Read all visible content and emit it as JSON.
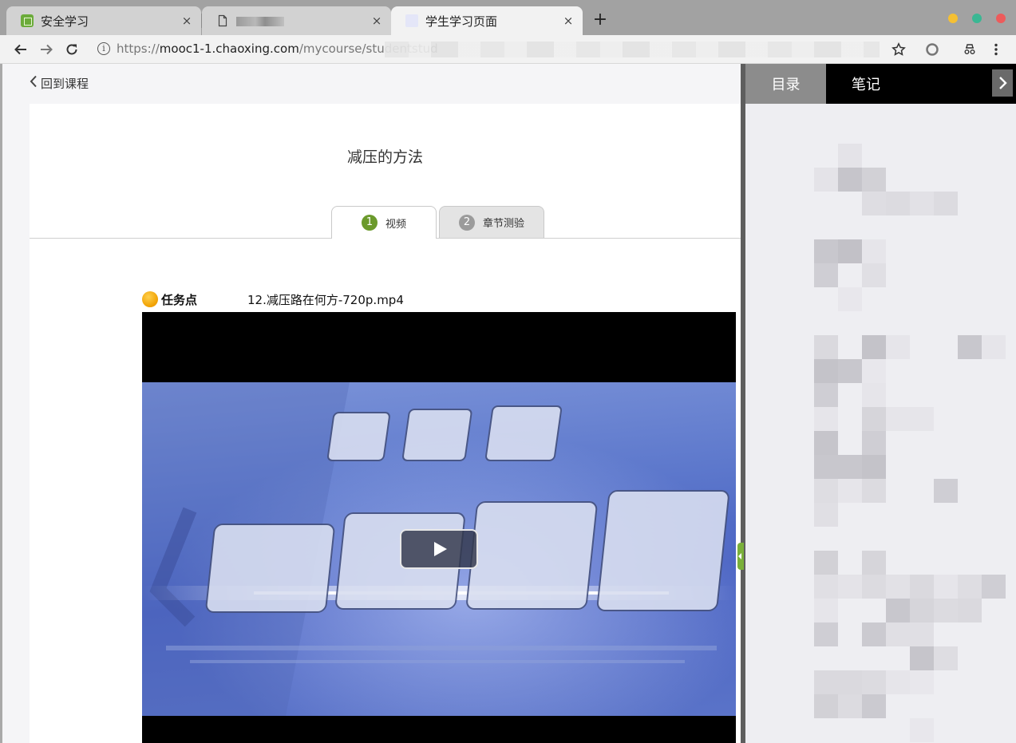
{
  "browser": {
    "tabs": [
      {
        "title": "安全学习",
        "close": "×",
        "icon": "chaoxing-favicon"
      },
      {
        "title": "",
        "close": "×",
        "icon": "document-icon"
      },
      {
        "title": "学生学习页面",
        "close": "×",
        "icon": "page-favicon"
      }
    ],
    "new_tab": "+",
    "url_prefix": "https://",
    "url_host": "mooc1-1.chaoxing.com",
    "url_path": "/mycourse/studentstud",
    "window_dots": [
      "#f5c033",
      "#3ab793",
      "#ed5b5b"
    ]
  },
  "page": {
    "back_label": "回到课程",
    "lesson_title": "减压的方法",
    "tabs": [
      {
        "num": "1",
        "label": "视频"
      },
      {
        "num": "2",
        "label": "章节测验"
      }
    ],
    "task_label": "任务点",
    "file_name": "12.减压路在何方-720p.mp4"
  },
  "sidebar": {
    "tabs": [
      "目录",
      "笔记"
    ],
    "expand_icon": "chevron-right-icon"
  },
  "colors": {
    "accent_green": "#6b9a2c",
    "task_orange": "#f0a000"
  }
}
